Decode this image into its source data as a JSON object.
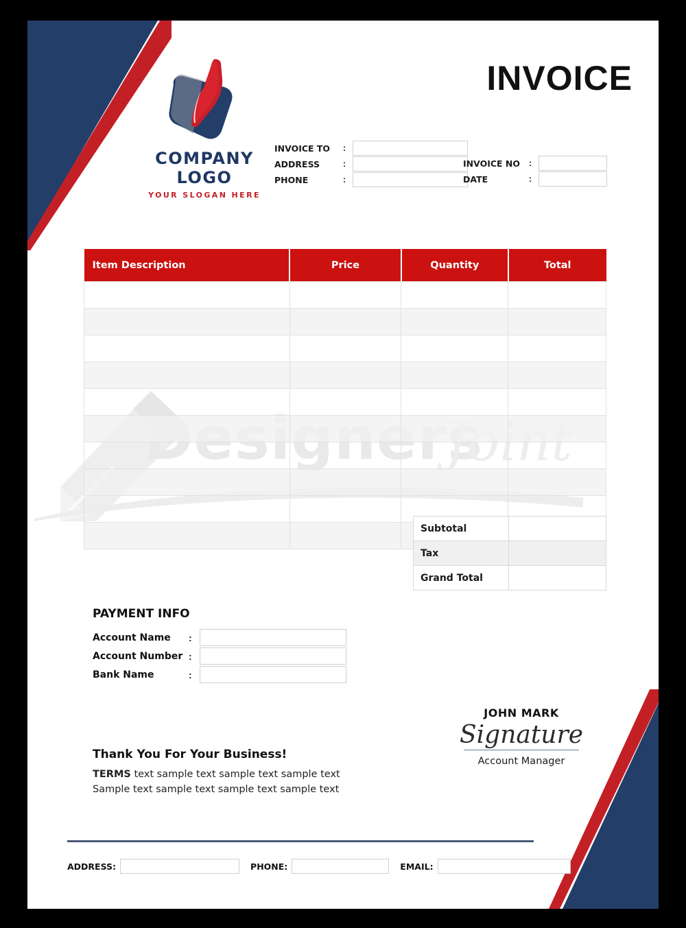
{
  "document": {
    "title": "INVOICE"
  },
  "brand": {
    "logo_icon": "company-logo-mark",
    "company_name": "COMPANY LOGO",
    "slogan": "YOUR SLOGAN HERE",
    "navy": "#233E69",
    "red": "#C32026",
    "table_header_red": "#CC1111"
  },
  "meta": {
    "left_fields": [
      {
        "label": "INVOICE TO",
        "colon": ":",
        "value": ""
      },
      {
        "label": "ADDRESS",
        "colon": ":",
        "value": ""
      },
      {
        "label": "PHONE",
        "colon": ":",
        "value": ""
      }
    ],
    "right_fields": [
      {
        "label": "INVOICE NO",
        "colon": ":",
        "value": ""
      },
      {
        "label": "DATE",
        "colon": ":",
        "value": ""
      }
    ]
  },
  "items_table": {
    "columns": [
      "Item Description",
      "Price",
      "Quantity",
      "Total"
    ],
    "rows": [
      {
        "description": "",
        "price": "",
        "quantity": "",
        "total": ""
      },
      {
        "description": "",
        "price": "",
        "quantity": "",
        "total": ""
      },
      {
        "description": "",
        "price": "",
        "quantity": "",
        "total": ""
      },
      {
        "description": "",
        "price": "",
        "quantity": "",
        "total": ""
      },
      {
        "description": "",
        "price": "",
        "quantity": "",
        "total": ""
      },
      {
        "description": "",
        "price": "",
        "quantity": "",
        "total": ""
      },
      {
        "description": "",
        "price": "",
        "quantity": "",
        "total": ""
      },
      {
        "description": "",
        "price": "",
        "quantity": "",
        "total": ""
      },
      {
        "description": "",
        "price": "",
        "quantity": "",
        "total": ""
      },
      {
        "description": "",
        "price": "",
        "quantity": "",
        "total": ""
      }
    ]
  },
  "totals": [
    {
      "label": "Subtotal",
      "value": ""
    },
    {
      "label": "Tax",
      "value": ""
    },
    {
      "label": "Grand Total",
      "value": ""
    }
  ],
  "payment_info": {
    "title": "PAYMENT INFO",
    "fields": [
      {
        "label": "Account Name",
        "colon": ":",
        "value": ""
      },
      {
        "label": "Account Number",
        "colon": ":",
        "value": ""
      },
      {
        "label": "Bank Name",
        "colon": ":",
        "value": ""
      }
    ]
  },
  "signature": {
    "name": "JOHN MARK",
    "script": "Signature",
    "role": "Account Manager"
  },
  "closing": {
    "thanks": "Thank You For Your Business!",
    "terms_prefix": "TERMS",
    "terms_line1": " text sample text sample text sample text",
    "terms_line2": "Sample text sample text sample text sample text"
  },
  "footer": {
    "address_label": "ADDRESS:",
    "address_value": "",
    "phone_label": "PHONE:",
    "phone_value": "",
    "email_label": "EMAIL:",
    "email_value": ""
  },
  "watermark": {
    "text": "Designers",
    "script": "Joint"
  }
}
